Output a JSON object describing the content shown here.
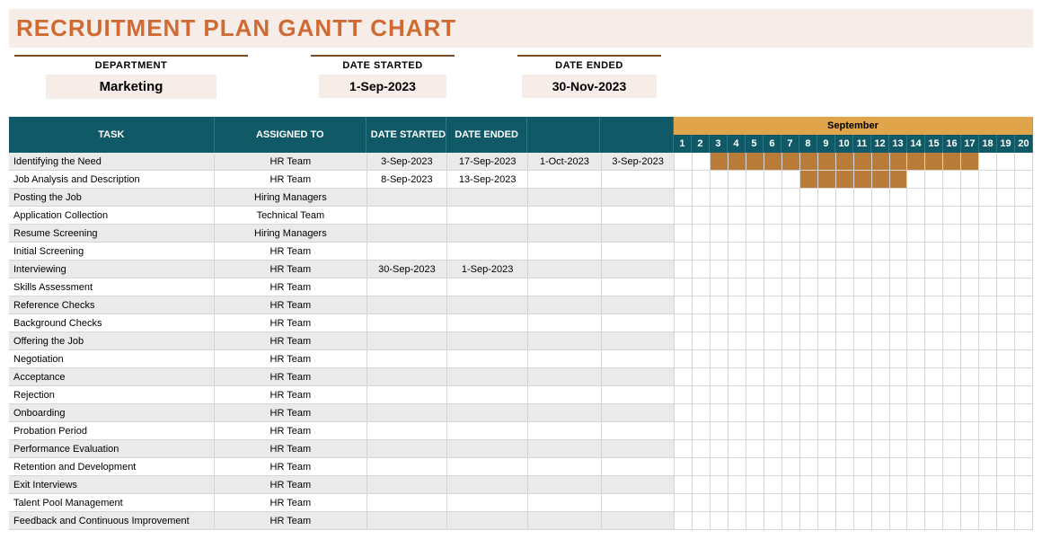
{
  "title": "RECRUITMENT PLAN GANTT CHART",
  "meta": {
    "department_label": "DEPARTMENT",
    "department_value": "Marketing",
    "date_started_label": "DATE STARTED",
    "date_started_value": "1-Sep-2023",
    "date_ended_label": "DATE ENDED",
    "date_ended_value": "30-Nov-2023"
  },
  "columns": {
    "task": "TASK",
    "assigned": "ASSIGNED TO",
    "date_started": "DATE STARTED",
    "date_ended": "DATE ENDED"
  },
  "timeline": {
    "month_label": "September",
    "days": [
      "1",
      "2",
      "3",
      "4",
      "5",
      "6",
      "7",
      "8",
      "9",
      "10",
      "11",
      "12",
      "13",
      "14",
      "15",
      "16",
      "17",
      "18",
      "19",
      "20"
    ]
  },
  "rows": [
    {
      "task": "Identifying the Need",
      "assigned": "HR Team",
      "dstart": "3-Sep-2023",
      "dend": "17-Sep-2023",
      "extra1": "1-Oct-2023",
      "extra2": "3-Sep-2023",
      "bar_start": 3,
      "bar_end": 17
    },
    {
      "task": "Job Analysis and Description",
      "assigned": "HR Team",
      "dstart": "8-Sep-2023",
      "dend": "13-Sep-2023",
      "extra1": "",
      "extra2": "",
      "bar_start": 8,
      "bar_end": 13
    },
    {
      "task": "Posting the Job",
      "assigned": "Hiring Managers",
      "dstart": "",
      "dend": "",
      "extra1": "",
      "extra2": ""
    },
    {
      "task": "Application Collection",
      "assigned": "Technical Team",
      "dstart": "",
      "dend": "",
      "extra1": "",
      "extra2": ""
    },
    {
      "task": "Resume Screening",
      "assigned": "Hiring Managers",
      "dstart": "",
      "dend": "",
      "extra1": "",
      "extra2": ""
    },
    {
      "task": "Initial Screening",
      "assigned": "HR Team",
      "dstart": "",
      "dend": "",
      "extra1": "",
      "extra2": ""
    },
    {
      "task": "Interviewing",
      "assigned": "HR Team",
      "dstart": "30-Sep-2023",
      "dend": "1-Sep-2023",
      "extra1": "",
      "extra2": ""
    },
    {
      "task": "Skills Assessment",
      "assigned": "HR Team",
      "dstart": "",
      "dend": "",
      "extra1": "",
      "extra2": ""
    },
    {
      "task": "Reference Checks",
      "assigned": "HR Team",
      "dstart": "",
      "dend": "",
      "extra1": "",
      "extra2": ""
    },
    {
      "task": "Background Checks",
      "assigned": "HR Team",
      "dstart": "",
      "dend": "",
      "extra1": "",
      "extra2": ""
    },
    {
      "task": "Offering the Job",
      "assigned": "HR Team",
      "dstart": "",
      "dend": "",
      "extra1": "",
      "extra2": ""
    },
    {
      "task": "Negotiation",
      "assigned": "HR Team",
      "dstart": "",
      "dend": "",
      "extra1": "",
      "extra2": ""
    },
    {
      "task": "Acceptance",
      "assigned": "HR Team",
      "dstart": "",
      "dend": "",
      "extra1": "",
      "extra2": ""
    },
    {
      "task": "Rejection",
      "assigned": "HR Team",
      "dstart": "",
      "dend": "",
      "extra1": "",
      "extra2": ""
    },
    {
      "task": "Onboarding",
      "assigned": "HR Team",
      "dstart": "",
      "dend": "",
      "extra1": "",
      "extra2": ""
    },
    {
      "task": "Probation Period",
      "assigned": "HR Team",
      "dstart": "",
      "dend": "",
      "extra1": "",
      "extra2": ""
    },
    {
      "task": "Performance Evaluation",
      "assigned": "HR Team",
      "dstart": "",
      "dend": "",
      "extra1": "",
      "extra2": ""
    },
    {
      "task": "Retention and Development",
      "assigned": "HR Team",
      "dstart": "",
      "dend": "",
      "extra1": "",
      "extra2": ""
    },
    {
      "task": "Exit Interviews",
      "assigned": "HR Team",
      "dstart": "",
      "dend": "",
      "extra1": "",
      "extra2": ""
    },
    {
      "task": "Talent Pool Management",
      "assigned": "HR Team",
      "dstart": "",
      "dend": "",
      "extra1": "",
      "extra2": ""
    },
    {
      "task": "Feedback and Continuous Improvement",
      "assigned": "HR Team",
      "dstart": "",
      "dend": "",
      "extra1": "",
      "extra2": ""
    }
  ],
  "chart_data": {
    "type": "gantt",
    "title": "Recruitment Plan Gantt Chart",
    "xlabel": "September",
    "x_range": [
      1,
      20
    ],
    "tasks": [
      {
        "name": "Identifying the Need",
        "start_day": 3,
        "end_day": 17
      },
      {
        "name": "Job Analysis and Description",
        "start_day": 8,
        "end_day": 13
      }
    ]
  }
}
